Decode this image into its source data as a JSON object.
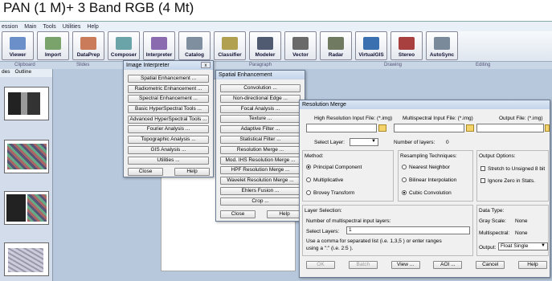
{
  "title": "PAN (1 M)+ 3 Band RGB (4 Mt)",
  "menu": [
    "ession",
    "Main",
    "Tools",
    "Utilities",
    "Help"
  ],
  "toolbar": [
    {
      "label": "Viewer",
      "color": "#6b8fc9"
    },
    {
      "label": "Import",
      "color": "#7aa36b"
    },
    {
      "label": "DataPrep",
      "color": "#c97b5a"
    },
    {
      "label": "Composer",
      "color": "#6aa3a8"
    },
    {
      "label": "Interpreter",
      "color": "#8a6bb0"
    },
    {
      "label": "Catalog",
      "color": "#7f8f9f"
    },
    {
      "label": "Classifier",
      "color": "#b0a050"
    },
    {
      "label": "Modeler",
      "color": "#505a70"
    },
    {
      "label": "Vector",
      "color": "#6a6a6a"
    },
    {
      "label": "Radar",
      "color": "#707a60"
    },
    {
      "label": "VirtualGIS",
      "color": "#3a6fb0"
    },
    {
      "label": "Stereo",
      "color": "#a84040"
    },
    {
      "label": "AutoSync",
      "color": "#7a8a9a"
    }
  ],
  "ribbon_groups": [
    "Clipboard",
    "Slides",
    "Paragraph",
    "Drawing",
    "Editing"
  ],
  "slide_tabs": [
    "des",
    "Outline"
  ],
  "interpreter": {
    "title": "Image Interpreter",
    "close_x": "x",
    "buttons": [
      "Spatial Enhancement ...",
      "Radiometric Enhancement ...",
      "Spectral Enhancement ...",
      "Basic HyperSpectral Tools ...",
      "Advanced HyperSpectral Tools ...",
      "Fourier Analysis ...",
      "Topographic Analysis ...",
      "GIS Analysis ...",
      "Utilities ..."
    ],
    "close": "Close",
    "help": "Help"
  },
  "spatial": {
    "title": "Spatial Enhancement",
    "buttons": [
      "Convolution ...",
      "Non-directional Edge ...",
      "Focal Analysis ...",
      "Texture ...",
      "Adaptive Filter ...",
      "Statistical Filter ...",
      "Resolution Merge ...",
      "Mod. IHS Resolution Merge ...",
      "HPF Resolution Merge ...",
      "Wavelet Resolution Merge ...",
      "Ehlers Fusion ...",
      "Crop ..."
    ],
    "close": "Close",
    "help": "Help"
  },
  "merge": {
    "title": "Resolution Merge",
    "high_label": "High Resolution Input File: (*.img)",
    "multi_label": "Multispectral Input File: (*.img)",
    "output_label": "Output File: (*.img)",
    "select_layer": "Select Layer:",
    "num_layers": "Number of layers:",
    "num_layers_value": "0",
    "method_title": "Method:",
    "methods": [
      "Principal Component",
      "Multiplicative",
      "Brovey Transform"
    ],
    "resampling_title": "Resampling Techniques:",
    "resampling": [
      "Nearest Neighbor",
      "Bilinear Interpolation",
      "Cubic Convolution"
    ],
    "output_options_title": "Output Options:",
    "output_options": [
      "Stretch to Unsigned 8 bit",
      "Ignore Zero in Stats."
    ],
    "layer_selection": "Layer Selection:",
    "num_ms_layers": "Number of multispectral input layers:",
    "select_layers": "Select Layers:",
    "select_layers_value": "1",
    "hint1": "Use a comma for separated list (i.e. 1,3,5 ) or enter ranges",
    "hint2": "using a \":\" (i.e. 2:5 ).",
    "data_type": "Data Type:",
    "gray_scale": "Gray Scale:",
    "gray_scale_value": "None",
    "multispectral": "Multispectral:",
    "multispectral_value": "None",
    "output": "Output:",
    "output_value": "Float Single",
    "buttons": [
      "OK",
      "Batch",
      "View ...",
      "AOI ...",
      "Cancel",
      "Help"
    ]
  }
}
